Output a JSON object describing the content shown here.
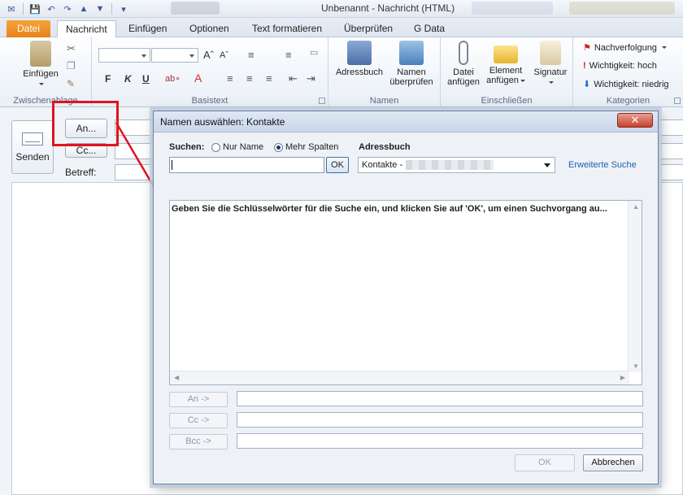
{
  "window": {
    "title_left": "Unbenannt",
    "title_sep": "-",
    "title_right": "Nachricht (HTML)"
  },
  "tabs": [
    {
      "label": "Datei"
    },
    {
      "label": "Nachricht"
    },
    {
      "label": "Einfügen"
    },
    {
      "label": "Optionen"
    },
    {
      "label": "Text formatieren"
    },
    {
      "label": "Überprüfen"
    },
    {
      "label": "G Data"
    }
  ],
  "ribbon": {
    "clipboard": {
      "paste_label": "Einfügen",
      "group_label": "Zwischenablage"
    },
    "basic_text": {
      "group_label": "Basistext",
      "bold": "F",
      "italic": "K",
      "underline": "U"
    },
    "names": {
      "addressbook_label": "Adressbuch",
      "check_names_line1": "Namen",
      "check_names_line2": "überprüfen",
      "group_label": "Namen"
    },
    "include": {
      "attach_file_line1": "Datei",
      "attach_file_line2": "anfügen",
      "attach_item_line1": "Element",
      "attach_item_line2": "anfügen",
      "signature_label": "Signatur",
      "group_label": "Einschließen"
    },
    "tags": {
      "followup_label": "Nachverfolgung",
      "importance_high": "Wichtigkeit: hoch",
      "importance_low": "Wichtigkeit: niedrig",
      "group_label": "Kategorien"
    }
  },
  "compose": {
    "send_label": "Senden",
    "to_label": "An...",
    "cc_label": "Cc...",
    "subject_label": "Betreff:"
  },
  "dialog": {
    "title": "Namen auswählen: Kontakte",
    "search_label": "Suchen:",
    "radio_name_only": "Nur Name",
    "radio_more_columns": "Mehr Spalten",
    "addressbook_label": "Adressbuch",
    "search_value": "",
    "ok_small": "OK",
    "addressbook_value": "Kontakte -",
    "advanced_search": "Erweiterte Suche",
    "results_message": "Geben Sie die Schlüsselwörter für die Suche ein, und klicken Sie auf 'OK', um einen Suchvorgang au...",
    "to_button": "An ->",
    "cc_button": "Cc ->",
    "bcc_button": "Bcc ->",
    "ok_button": "OK",
    "cancel_button": "Abbrechen"
  },
  "colors": {
    "file_tab": "#e9801c",
    "highlight": "#e0141e",
    "close_button": "#c7402e",
    "link": "#1f5fb0"
  }
}
